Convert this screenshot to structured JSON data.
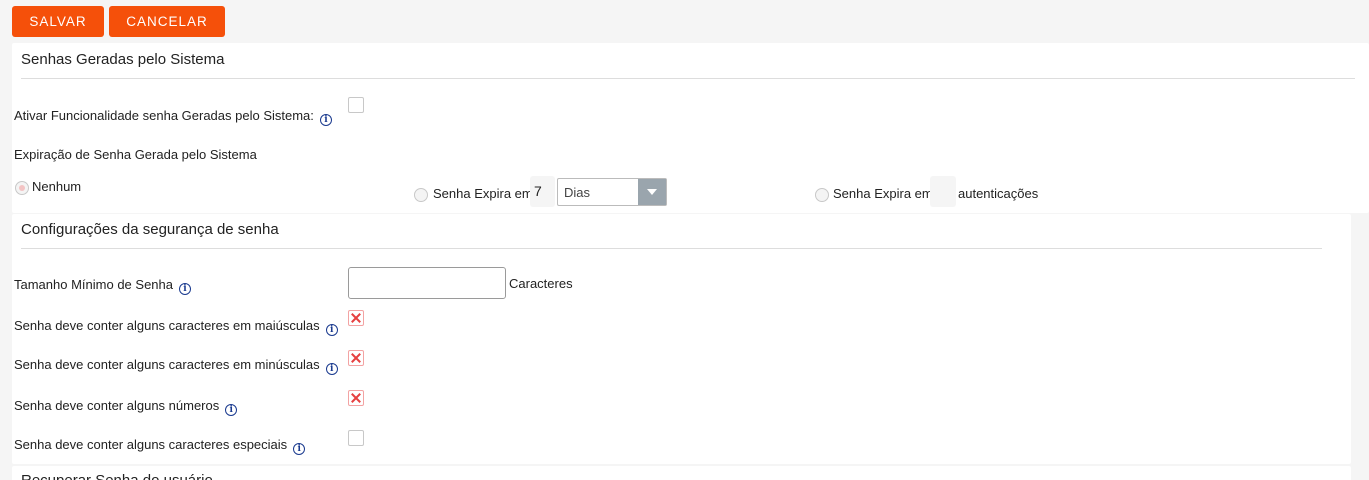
{
  "toolbar": {
    "save_label": "SALVAR",
    "cancel_label": "CANCELAR"
  },
  "colors": {
    "accent": "#f5500a",
    "checked_mark": "#e64040",
    "info_icon": "#1a3a8f"
  },
  "system_passwords": {
    "title": "Senhas Geradas pelo Sistema",
    "enable_label": "Ativar Funcionalidade senha Geradas pelo Sistema:",
    "enable_checked": false,
    "expiration_label": "Expiração de Senha Gerada pelo Sistema",
    "options": {
      "none_label": "Nenhum",
      "days_label": "Senha Expira em",
      "days_value": "7",
      "days_unit": "Dias",
      "auth_label": "Senha Expira em",
      "auth_value": "",
      "auth_suffix": "autenticações"
    },
    "selected_option": "none"
  },
  "security": {
    "title": "Configurações da segurança de senha",
    "min_length_label": "Tamanho Mínimo de Senha",
    "min_length_value": "",
    "min_length_suffix": "Caracteres",
    "uppercase_label": "Senha deve conter alguns caracteres em maiúsculas",
    "uppercase_checked": true,
    "lowercase_label": "Senha deve conter alguns caracteres em minúsculas",
    "lowercase_checked": true,
    "numbers_label": "Senha deve conter alguns números",
    "numbers_checked": true,
    "special_label": "Senha deve conter alguns caracteres especiais",
    "special_checked": false
  },
  "recover": {
    "title": "Recuperar Senha do usuário"
  }
}
